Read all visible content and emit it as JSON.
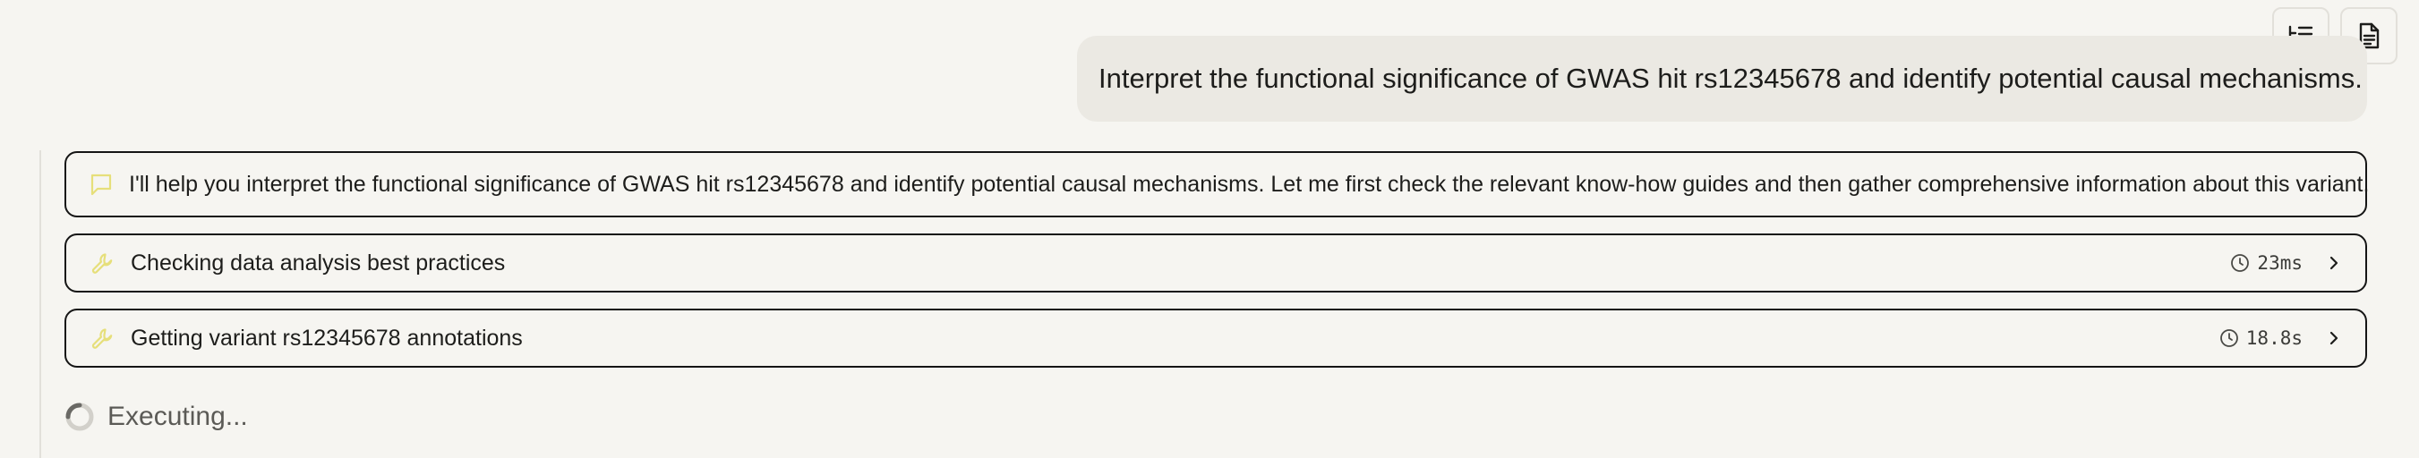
{
  "toolbar": {
    "outline_icon": "list-outline-icon",
    "document_icon": "document-icon"
  },
  "user_message": {
    "text": "Interpret the functional significance of GWAS hit rs12345678 and identify potential causal mechanisms."
  },
  "steps": [
    {
      "icon": "chat-bubble-icon",
      "label": "I'll help you interpret the functional significance of GWAS hit rs12345678 and identify potential causal mechanisms. Let me first check the relevant know-how guides and then gather comprehensive information about this variant."
    },
    {
      "icon": "wrench-icon",
      "label": "Checking data analysis best practices",
      "duration": "23ms"
    },
    {
      "icon": "wrench-icon",
      "label": "Getting variant rs12345678 annotations",
      "duration": "18.8s"
    }
  ],
  "status": {
    "label": "Executing..."
  },
  "colors": {
    "background": "#f6f5f1",
    "user_bubble": "#ebe9e3",
    "step_border": "#151515",
    "icon_accent": "#e6df7a"
  }
}
